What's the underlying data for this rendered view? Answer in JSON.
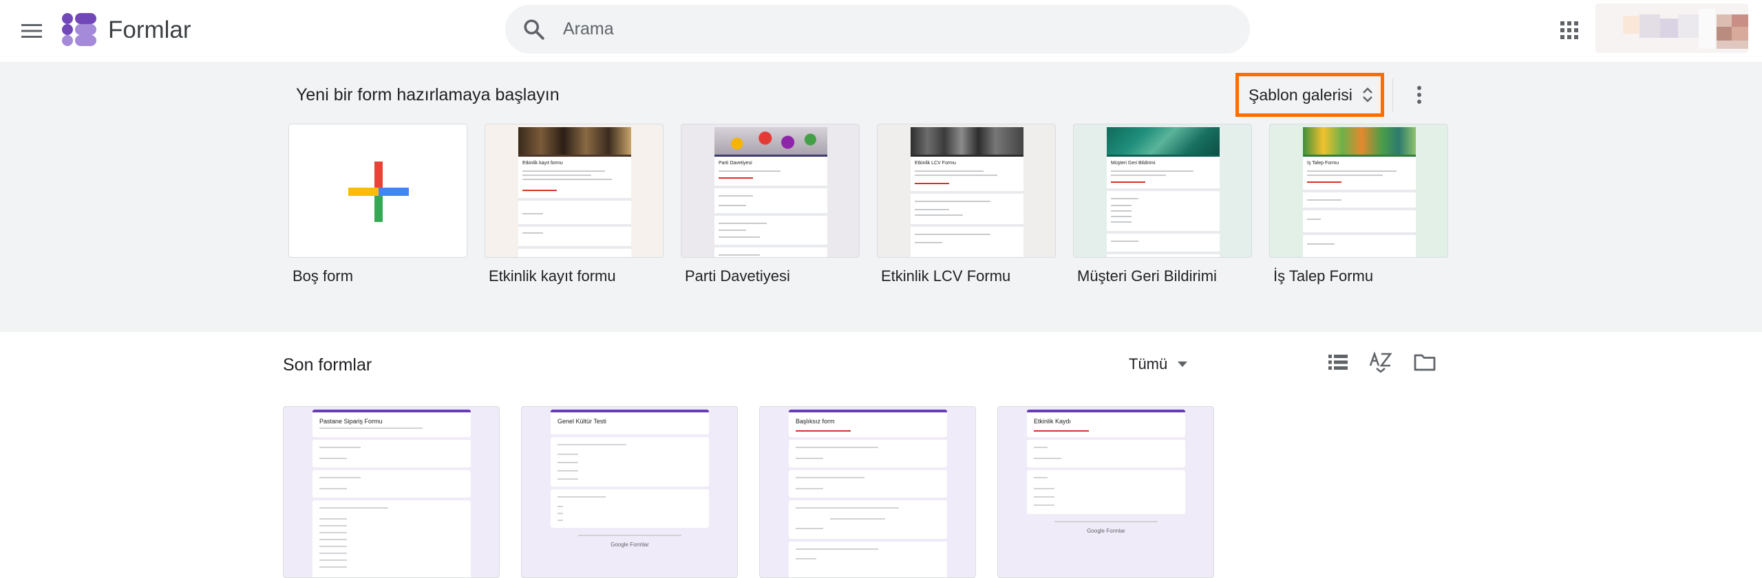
{
  "header": {
    "app_title": "Formlar",
    "search_placeholder": "Arama",
    "icons": {
      "menu": "hamburger-menu-icon",
      "logo": "forms-logo-icon",
      "search": "search-icon",
      "apps": "apps-grid-icon"
    }
  },
  "templates": {
    "heading": "Yeni bir form hazırlamaya başlayın",
    "gallery_label": "Şablon galerisi",
    "items": [
      {
        "label": "Boş form"
      },
      {
        "label": "Etkinlik kayıt formu",
        "preview_title": "Etkinlik kayıt formu"
      },
      {
        "label": "Parti Davetiyesi",
        "preview_title": "Parti Davetiyesi"
      },
      {
        "label": "Etkinlik LCV Formu",
        "preview_title": "Etkinlik LCV Formu"
      },
      {
        "label": "Müşteri Geri Bildirimi",
        "preview_title": "Müşteri Geri Bildirimi"
      },
      {
        "label": "İş Talep Formu",
        "preview_title": "İş Talep Formu"
      }
    ]
  },
  "recent": {
    "heading": "Son formlar",
    "owner_filter": "Tümü",
    "docs": [
      {
        "title": "Pastane Sipariş Formu"
      },
      {
        "title": "Genel Kültür Testi",
        "footer": "Google Formlar"
      },
      {
        "title": "Başlıksız form"
      },
      {
        "title": "Etkinlik Kaydı",
        "footer": "Google Formlar"
      }
    ]
  },
  "colors": {
    "header_bg": "#ffffff",
    "template_bg": "#f1f3f4",
    "highlight": "#ff6d00",
    "form_accent": "#673ab7",
    "doc_bg": "#f0ebf8"
  }
}
